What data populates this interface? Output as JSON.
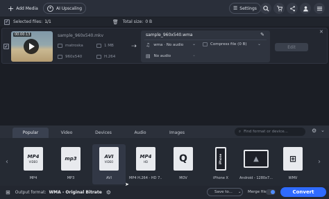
{
  "toolbar": {
    "add_media": "Add Media",
    "ai_upscaling": "AI Upscaling",
    "settings": "Settings"
  },
  "selection": {
    "selected_label": "Selected files:",
    "selected_value": "1/1",
    "total_label": "Total size:",
    "total_value": "0 B"
  },
  "file": {
    "duration": "00:00:13",
    "source_name": "sample_960x540.mkv",
    "container": "matroska",
    "size": "1 MB",
    "resolution": "960x540",
    "codec": "H.264",
    "output_name": "sample_960x540.wma",
    "audio_track": "wma · No audio",
    "compress": "Compress file (0 B)",
    "subtitle": "No audio",
    "edit": "Edit"
  },
  "tabs": [
    "Popular",
    "Video",
    "Devices",
    "Audio",
    "Images"
  ],
  "format_search_placeholder": "Find format or device...",
  "formats": [
    {
      "label": "MP4",
      "icon": "MP4",
      "sub": "VIDEO"
    },
    {
      "label": "MP3",
      "icon": "mp3",
      "sub": ""
    },
    {
      "label": "AVI",
      "icon": "AVI",
      "sub": "VIDEO"
    },
    {
      "label": "MP4 H.264 - HD 7...",
      "icon": "MP4",
      "sub": "HD"
    },
    {
      "label": "MOV",
      "icon": "Q",
      "sub": ""
    },
    {
      "label": "iPhone X",
      "icon": "iPhone",
      "sub": ""
    },
    {
      "label": "Android - 1280x7...",
      "icon": "android",
      "sub": ""
    },
    {
      "label": "WMV",
      "icon": "WMV",
      "sub": ""
    }
  ],
  "bottom": {
    "output_label": "Output format:",
    "output_value": "WMA - Original Bitrate",
    "save_to": "Save to...",
    "merge": "Merge files:",
    "convert": "Convert"
  },
  "colors": {
    "accent": "#2f6bff",
    "background": "#1b1e25"
  }
}
